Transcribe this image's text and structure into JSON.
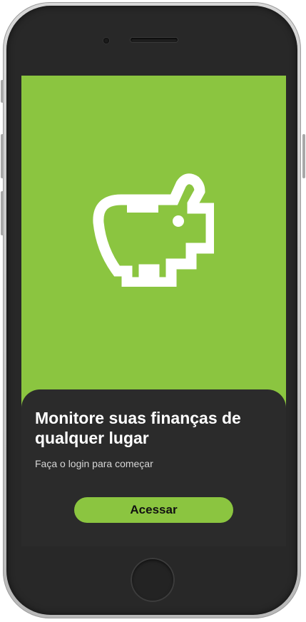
{
  "onboarding": {
    "title": "Monitore suas finanças de qualquer lugar",
    "subtitle": "Faça o login para começar",
    "cta_label": "Acessar",
    "hero_icon": "piggy-bank-icon"
  },
  "colors": {
    "accent": "#8bc540",
    "sheet_background": "#2b2b2b",
    "title_text": "#ffffff",
    "subtitle_text": "#d6d6d6",
    "device_frame": "#282828"
  }
}
